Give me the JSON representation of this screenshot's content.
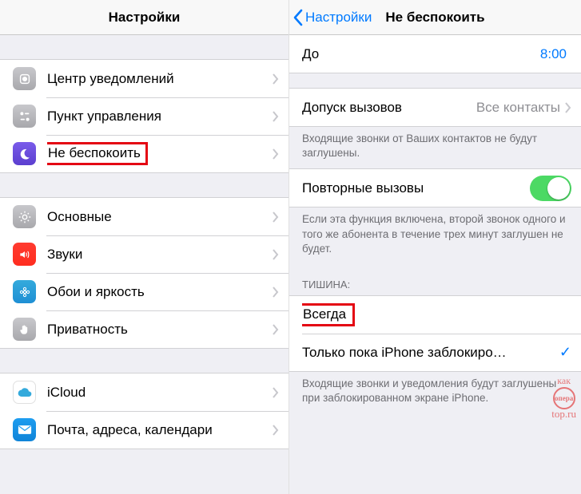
{
  "left": {
    "title": "Настройки",
    "group1": [
      {
        "label": "Центр уведомлений"
      },
      {
        "label": "Пункт управления"
      },
      {
        "label": "Не беспокоить",
        "highlight": true
      }
    ],
    "group2": [
      {
        "label": "Основные"
      },
      {
        "label": "Звуки"
      },
      {
        "label": "Обои и яркость"
      },
      {
        "label": "Приватность"
      }
    ],
    "group3": [
      {
        "label": "iCloud"
      },
      {
        "label": "Почта, адреса, календари"
      }
    ]
  },
  "right": {
    "back": "Настройки",
    "title": "Не беспокоить",
    "until": {
      "label": "До",
      "value": "8:00"
    },
    "allow": {
      "label": "Допуск вызовов",
      "value": "Все контакты"
    },
    "allow_note": "Входящие звонки от Ваших контактов не будут заглушены.",
    "repeat": {
      "label": "Повторные вызовы"
    },
    "repeat_note": "Если эта функция включена, второй звонок одного и того же абонента в течение трех минут заглушен не будет.",
    "silence_header": "ТИШИНА:",
    "opt_always": "Всегда",
    "opt_locked": "Только пока iPhone заблокиро…",
    "silence_note": "Входящие звонки и уведомления будут заглушены при заблокированном экране iPhone.",
    "watermark": {
      "top": "как",
      "mid": "опера",
      "bot": "top.ru"
    }
  }
}
